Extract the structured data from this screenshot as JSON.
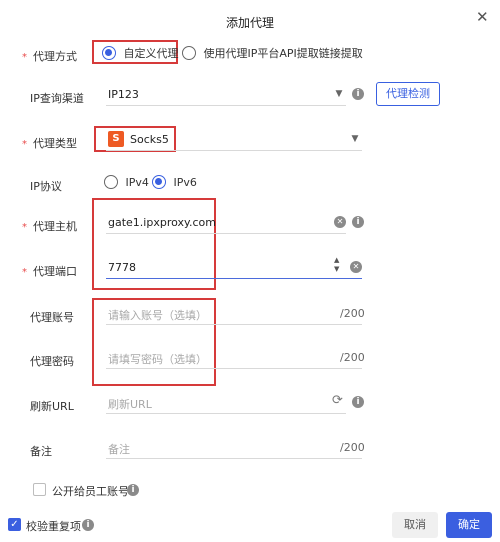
{
  "dialog": {
    "title": "添加代理",
    "close_icon": "close-icon"
  },
  "proxy_method": {
    "label": "代理方式",
    "options": [
      "自定义代理",
      "使用代理IP平台API提取链接提取"
    ],
    "selected": "自定义代理"
  },
  "ip_channel": {
    "label": "IP查询渠道",
    "value": "IP123",
    "check_button": "代理检测"
  },
  "proxy_type": {
    "label": "代理类型",
    "value": "Socks5",
    "logo_letter": "S"
  },
  "ip_protocol": {
    "label": "IP协议",
    "options": [
      "IPv4",
      "IPv6"
    ],
    "selected": "IPv6"
  },
  "proxy_host": {
    "label": "代理主机",
    "value": "gate1.ipxproxy.com"
  },
  "proxy_port": {
    "label": "代理端口",
    "value": "7778"
  },
  "proxy_account": {
    "label": "代理账号",
    "placeholder": "请输入账号（选填）",
    "counter": "/200"
  },
  "proxy_password": {
    "label": "代理密码",
    "placeholder": "请填写密码（选填）",
    "counter": "/200"
  },
  "refresh_url": {
    "label": "刷新URL",
    "placeholder": "刷新URL"
  },
  "remark": {
    "label": "备注",
    "placeholder": "备注",
    "counter": "/200"
  },
  "share_checkbox": {
    "label": "公开给员工账号",
    "checked": false
  },
  "footer": {
    "verify_label": "校验重复项",
    "verify_checked": true,
    "cancel": "取消",
    "confirm": "确定"
  },
  "colors": {
    "accent": "#3b5fe0",
    "highlight": "#d63a3a",
    "required": "#e84b4b"
  }
}
